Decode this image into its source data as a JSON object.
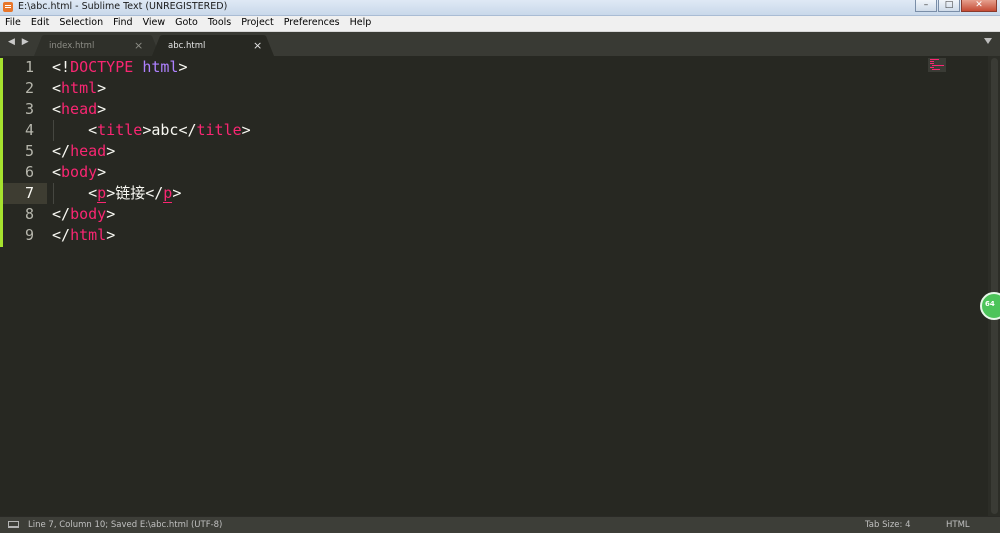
{
  "window": {
    "title": "E:\\abc.html - Sublime Text (UNREGISTERED)",
    "controls": {
      "minimize": "–",
      "maximize": "□",
      "close": "✕"
    }
  },
  "menu": {
    "file": "File",
    "edit": "Edit",
    "selection": "Selection",
    "find": "Find",
    "view": "View",
    "goto": "Goto",
    "tools": "Tools",
    "project": "Project",
    "preferences": "Preferences",
    "help": "Help"
  },
  "tabs": {
    "nav_arrows": "◀ ▶",
    "items": [
      {
        "label": "index.html",
        "close": "×",
        "active": false
      },
      {
        "label": "abc.html",
        "close": "×",
        "active": true
      }
    ]
  },
  "editor": {
    "line_numbers": [
      "1",
      "2",
      "3",
      "4",
      "5",
      "6",
      "7",
      "8",
      "9"
    ],
    "current_line": 7,
    "lines": {
      "l1": {
        "open": "<!",
        "kw": "DOCTYPE",
        "sp": " ",
        "attr": "html",
        "close": ">"
      },
      "l2": {
        "open": "<",
        "tag": "html",
        "close": ">"
      },
      "l3": {
        "open": "<",
        "tag": "head",
        "close": ">"
      },
      "l4": {
        "indent": "    ",
        "open": "<",
        "tag": "title",
        "mid": ">",
        "text": "abc",
        "open2": "</",
        "tag2": "title",
        "close": ">"
      },
      "l5": {
        "open": "</",
        "tag": "head",
        "close": ">"
      },
      "l6": {
        "open": "<",
        "tag": "body",
        "close": ">"
      },
      "l7": {
        "indent": "    ",
        "open": "<",
        "tag": "p",
        "mid": ">",
        "text": "链接",
        "open2": "</",
        "tag2": "p",
        "close": ">"
      },
      "l8": {
        "open": "</",
        "tag": "body",
        "close": ">"
      },
      "l9": {
        "open": "</",
        "tag": "html",
        "close": ">"
      }
    },
    "badge_text": "64"
  },
  "status": {
    "left": "Line 7, Column 10; Saved E:\\abc.html (UTF-8)",
    "tab_size": "Tab Size: 4",
    "syntax": "HTML"
  },
  "colors": {
    "background": "#272822",
    "tag": "#f92672",
    "attribute": "#ae81ff",
    "text": "#f8f8f2",
    "modified_gutter": "#a6e22e"
  }
}
